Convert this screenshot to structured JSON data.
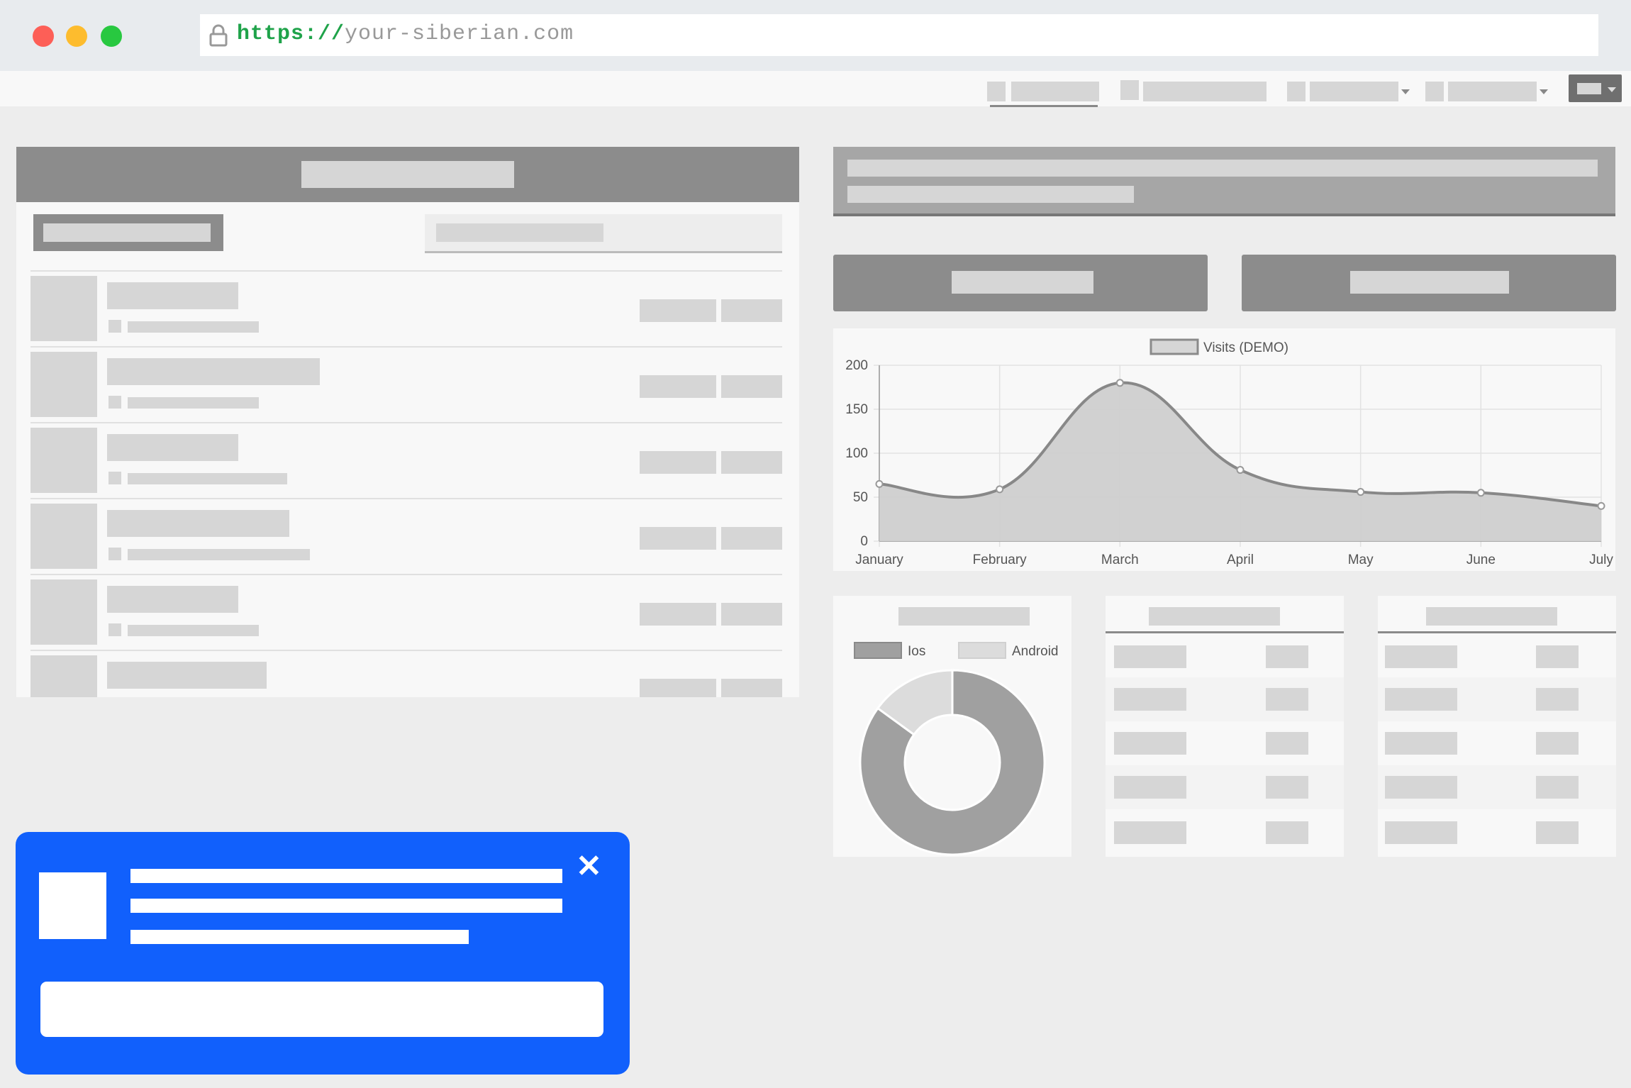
{
  "browser": {
    "url_scheme": "https://",
    "url_host": "your-siberian.com",
    "traffic_light_colors": [
      "#fd5f57",
      "#fdbc2e",
      "#28c840"
    ],
    "lock_icon": "lock-icon"
  },
  "colors": {
    "popup_accent": "#1160fc",
    "url_scheme": "#1fa34a",
    "placeholder": "#d6d6d6",
    "header_gray": "#8c8c8c"
  },
  "popup": {
    "close_label": "✕"
  },
  "chart_data": [
    {
      "type": "area",
      "legend": [
        "Visits (DEMO)"
      ],
      "legend_position": "top-center",
      "x": [
        "January",
        "February",
        "March",
        "April",
        "May",
        "June",
        "July"
      ],
      "series": [
        {
          "name": "Visits (DEMO)",
          "values": [
            65,
            59,
            180,
            81,
            56,
            55,
            40
          ]
        }
      ],
      "yticks": [
        "0",
        "50",
        "100",
        "150",
        "200"
      ],
      "ylim": [
        0,
        200
      ],
      "grid": true
    },
    {
      "type": "pie",
      "variant": "doughnut",
      "legend_position": "top-left",
      "categories": [
        "Ios",
        "Android"
      ],
      "series": [
        {
          "name": "",
          "values": [
            85,
            15
          ]
        }
      ],
      "colors": [
        "#a0a0a0",
        "#dcdcdc"
      ]
    }
  ]
}
